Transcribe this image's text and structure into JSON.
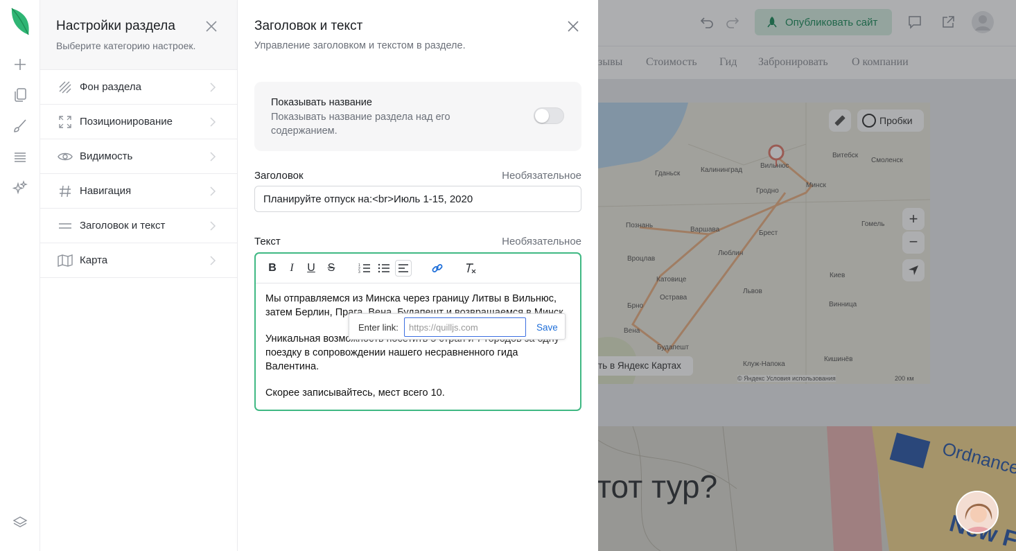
{
  "rail": {
    "icons": [
      "leaf-logo",
      "plus-icon",
      "pages-icon",
      "brush-icon",
      "sections-icon",
      "sparkles-icon",
      "layers-icon"
    ]
  },
  "settings": {
    "title": "Настройки раздела",
    "subtitle": "Выберите категорию настроек.",
    "items": [
      {
        "label": "Фон раздела",
        "icon": "background-icon"
      },
      {
        "label": "Позиционирование",
        "icon": "position-icon"
      },
      {
        "label": "Видимость",
        "icon": "eye-icon"
      },
      {
        "label": "Навигация",
        "icon": "hash-icon"
      },
      {
        "label": "Заголовок и текст",
        "icon": "text-lines-icon"
      },
      {
        "label": "Карта",
        "icon": "map-icon"
      }
    ]
  },
  "panel": {
    "title": "Заголовок и текст",
    "subtitle": "Управление заголовком и текстом в разделе.",
    "show_title": {
      "label": "Показывать название",
      "description": "Показывать название раздела над его содержанием.",
      "enabled": false
    },
    "heading_field": {
      "label": "Заголовок",
      "optional": "Необязательное",
      "value": "Планируйте отпуск на:<br>Июль 1-15, 2020"
    },
    "text_field": {
      "label": "Текст",
      "optional": "Необязательное",
      "paragraphs": [
        "Мы отправляемся из Минска через границу Литвы в Вильнюс, затем Берлин, Прага, Вена, Будапешт и возвращаемся в Минск.",
        "Уникальная возможность посетить 5 стран и 7 городов за одну поездку в сопровождении нашего несравненного гида Валентина.",
        "Скорее записывайтесь, мест всего 10."
      ]
    },
    "link_popup": {
      "label": "Enter link:",
      "placeholder": "https://quilljs.com",
      "save": "Save"
    }
  },
  "preview": {
    "publish_label": "Опубликовать сайт",
    "nav": [
      "зывы",
      "Стоимость",
      "Гид",
      "Забронировать",
      "О компании"
    ],
    "map": {
      "traffic_label": "Пробки",
      "open_label": "ть в Яндекс Картах",
      "copyright": "© Яндекс  Условия использования",
      "scale": "200 км",
      "cities": [
        "Вильнюс",
        "Минск",
        "Варшава",
        "Брест",
        "Гродно",
        "Калининград",
        "Гданьск",
        "Познань",
        "Вроцлав",
        "Катовице",
        "Люблин",
        "Львов",
        "Киев",
        "Брно",
        "Вена",
        "Будапешт",
        "Витебск",
        "Смоленск",
        "Гомель",
        "Винница",
        "Кишинёв",
        "Клуж-Напока",
        "Острава"
      ]
    },
    "lower_text": "тот тур?"
  }
}
